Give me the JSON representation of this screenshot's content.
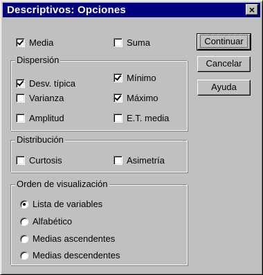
{
  "window": {
    "title": "Descriptivos: Opciones",
    "close_glyph": "×"
  },
  "top": {
    "media": "Media",
    "suma": "Suma"
  },
  "dispersion": {
    "label": "Dispersión",
    "desv_tipica": "Desv. típica",
    "minimo": "Mínimo",
    "varianza": "Varianza",
    "maximo": "Máximo",
    "amplitud": "Amplitud",
    "et_media": "E.T. media"
  },
  "distribucion": {
    "label": "Distribución",
    "curtosis": "Curtosis",
    "asimetria": "Asimetría"
  },
  "orden": {
    "label": "Orden de visualización",
    "options": [
      "Lista de variables",
      "Alfabético",
      "Medias ascendentes",
      "Medias descendentes"
    ],
    "selected": "Lista de variables"
  },
  "buttons": {
    "continuar": "Continuar",
    "cancelar": "Cancelar",
    "ayuda": "Ayuda"
  },
  "checked": {
    "media": true,
    "suma": false,
    "desv_tipica": true,
    "minimo": true,
    "varianza": false,
    "maximo": true,
    "amplitud": false,
    "et_media": false,
    "curtosis": false,
    "asimetria": false
  },
  "colors": {
    "titlebar": "#000080",
    "face": "#c0c0c0"
  },
  "icons": {
    "check": "check-icon",
    "close": "close-icon"
  }
}
